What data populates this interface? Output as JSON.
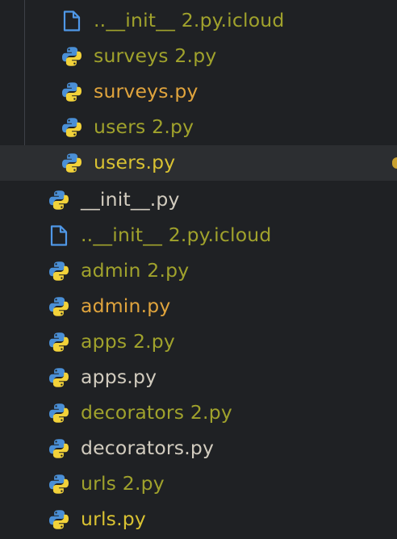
{
  "colors": {
    "background": "#1f2124",
    "selected_row": "#2c2e31",
    "guide_line": "#3e4147",
    "olive_text": "#a0a22c",
    "orange_text": "#e0a43d",
    "light_text": "#d2ccbf",
    "yellow_text": "#d9c232",
    "python_blue": "#4a8fd6",
    "python_yellow": "#f2d23a",
    "file_icon_blue": "#4f98e8"
  },
  "files": [
    {
      "name": "..__init__ 2.py.icloud",
      "icon": "file-icon",
      "color": "olive",
      "level": 2,
      "selected": false
    },
    {
      "name": "surveys 2.py",
      "icon": "python-icon",
      "color": "olive",
      "level": 2,
      "selected": false
    },
    {
      "name": "surveys.py",
      "icon": "python-icon",
      "color": "orange",
      "level": 2,
      "selected": false
    },
    {
      "name": "users 2.py",
      "icon": "python-icon",
      "color": "olive",
      "level": 2,
      "selected": false
    },
    {
      "name": "users.py",
      "icon": "python-icon",
      "color": "yellow",
      "level": 2,
      "selected": true
    },
    {
      "name": "__init__.py",
      "icon": "python-icon",
      "color": "light",
      "level": 1,
      "selected": false
    },
    {
      "name": "..__init__ 2.py.icloud",
      "icon": "file-icon",
      "color": "olive",
      "level": 1,
      "selected": false
    },
    {
      "name": "admin 2.py",
      "icon": "python-icon",
      "color": "olive",
      "level": 1,
      "selected": false
    },
    {
      "name": "admin.py",
      "icon": "python-icon",
      "color": "orange",
      "level": 1,
      "selected": false
    },
    {
      "name": "apps 2.py",
      "icon": "python-icon",
      "color": "olive",
      "level": 1,
      "selected": false
    },
    {
      "name": "apps.py",
      "icon": "python-icon",
      "color": "light",
      "level": 1,
      "selected": false
    },
    {
      "name": "decorators 2.py",
      "icon": "python-icon",
      "color": "olive",
      "level": 1,
      "selected": false
    },
    {
      "name": "decorators.py",
      "icon": "python-icon",
      "color": "light",
      "level": 1,
      "selected": false
    },
    {
      "name": "urls 2.py",
      "icon": "python-icon",
      "color": "olive",
      "level": 1,
      "selected": false
    },
    {
      "name": "urls.py",
      "icon": "python-icon",
      "color": "yellow",
      "level": 1,
      "selected": false
    }
  ]
}
